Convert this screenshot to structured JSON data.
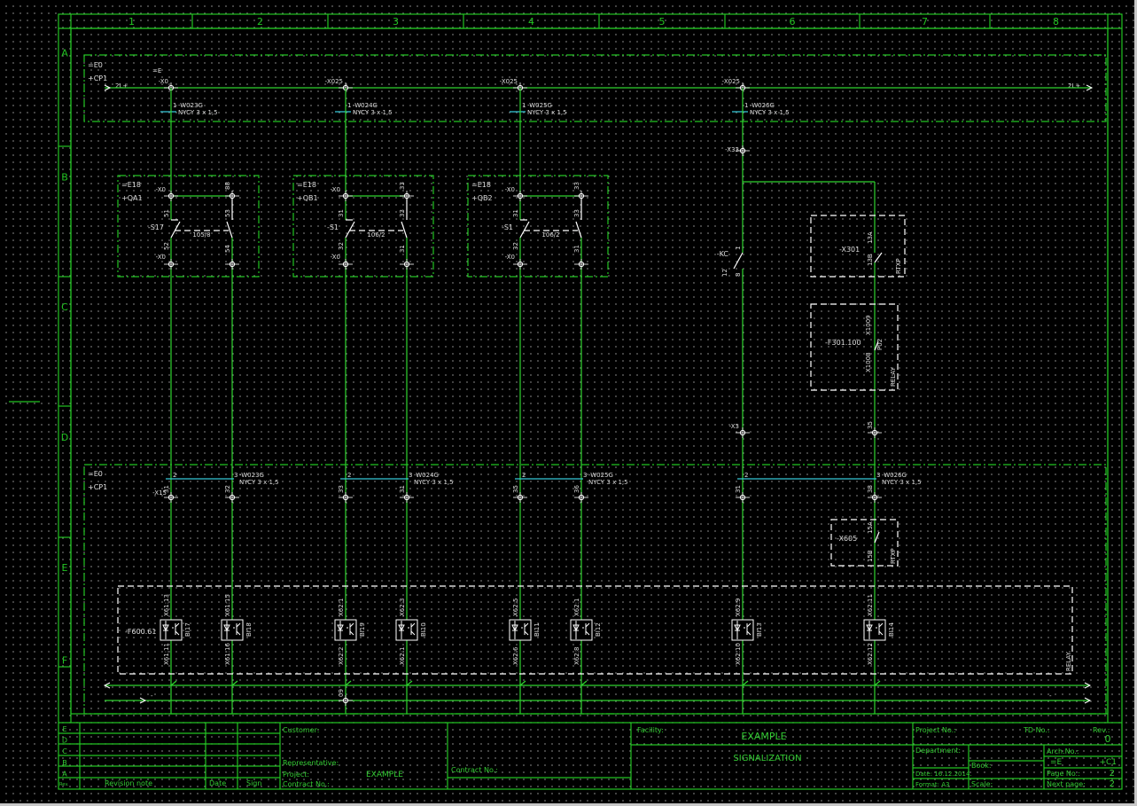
{
  "colors": {
    "frame": "#22c322",
    "wire": "#2fd42f",
    "cable": "#35c8d8",
    "symbol": "#ffffff",
    "text": "#dddddd",
    "title_text": "#33cc33"
  },
  "frame": {
    "columns": [
      "1",
      "2",
      "3",
      "4",
      "5",
      "6",
      "7",
      "8"
    ],
    "rows": [
      "A",
      "B",
      "C",
      "D",
      "E",
      "F"
    ]
  },
  "top": {
    "loc": "=E0",
    "plus": "+CP1",
    "eq": "=E",
    "net_left": "2L+",
    "net_right": "2L+",
    "terminals": [
      "-X0",
      "-X025",
      "-X025",
      "-X025"
    ],
    "cables": [
      {
        "pin": "1",
        "name": "-W023G",
        "type": "NYCY  3 x 1,5"
      },
      {
        "pin": "1",
        "name": "-W024G",
        "type": "NYCY  3 x 1,5"
      },
      {
        "pin": "1",
        "name": "-W025G",
        "type": "NYCY  3 x 1,5"
      },
      {
        "pin": "1",
        "name": "-W026G",
        "type": "NYCY  3 x 1,5"
      }
    ],
    "x3_top": "-X33"
  },
  "modules": [
    {
      "loc": "=E18",
      "plus": "+QA1",
      "term": "-X0",
      "dev": "-S17",
      "ref": "105/8",
      "pins": [
        "51",
        "52",
        "53",
        "54"
      ],
      "tp": [
        "",
        "",
        "88",
        "181"
      ]
    },
    {
      "loc": "=E18",
      "plus": "+QB1",
      "term": "-X0",
      "dev": "-S1",
      "ref": "106/2",
      "pins": [
        "31",
        "32",
        "33",
        "31"
      ],
      "tp": [
        "31",
        "32",
        "33",
        "31"
      ]
    },
    {
      "loc": "=E18",
      "plus": "+QB2",
      "term": "-X0",
      "dev": "-S1",
      "ref": "106/2",
      "pins": [
        "31",
        "32",
        "33",
        "31"
      ],
      "tp": [
        "31",
        "32",
        "33",
        "31"
      ]
    }
  ],
  "kc": {
    "dev": "-KC",
    "pins": [
      "1",
      "12",
      "8"
    ]
  },
  "x301": {
    "dev": "-X301",
    "pins": [
      "13A",
      "13B"
    ],
    "type": "RTXP"
  },
  "f301": {
    "dev": "-F301.100",
    "pins": [
      "X1009",
      "X1008"
    ],
    "code": "P02",
    "type": "RELAY"
  },
  "x3_bottom": {
    "term": "-X3",
    "pin": "35"
  },
  "bottom": {
    "loc": "=E0",
    "plus": "+CP1",
    "term": "-X15",
    "cables": [
      {
        "a": "2",
        "b": "3",
        "name": "-W023G",
        "type": "NYCY  3 x 1,5"
      },
      {
        "a": "2",
        "b": "3",
        "name": "-W024G",
        "type": "NYCY  3 x 1,5"
      },
      {
        "a": "2",
        "b": "3",
        "name": "-W025G",
        "type": "NYCY  3 x 1,5"
      },
      {
        "a": "2",
        "b": "3",
        "name": "-W026G",
        "type": "NYCY  3 x 1,5"
      }
    ],
    "terms": [
      "31",
      "32",
      "33",
      "31",
      "35",
      "36",
      "31",
      "38"
    ]
  },
  "x605": {
    "dev": "-X605",
    "pins": [
      "15A",
      "15B"
    ],
    "type": "RTXP"
  },
  "relay": {
    "dev": "-F600.61",
    "type": "RELAY",
    "inputs": [
      {
        "top": "X61:13",
        "bot": "X61:11",
        "bi": "BI17"
      },
      {
        "top": "X61:15",
        "bot": "X61:16",
        "bi": "BI18"
      },
      {
        "top": "X62:1",
        "bot": "X62:2",
        "bi": "BI19"
      },
      {
        "top": "X62:3",
        "bot": "X62:1",
        "bi": "BI10"
      },
      {
        "top": "X62:5",
        "bot": "X62:6",
        "bi": "BI11"
      },
      {
        "top": "X62:1",
        "bot": "X62:8",
        "bi": "BI12"
      },
      {
        "top": "X62:9",
        "bot": "X62:10",
        "bi": "BI13"
      },
      {
        "top": "X62:11",
        "bot": "X62:12",
        "bi": "BI14"
      }
    ],
    "bus_term": "09",
    "bus_minus": "-"
  },
  "title_block": {
    "rev_rows": [
      "E",
      "D",
      "C",
      "B",
      "A"
    ],
    "rev_header": {
      "num": "Rev.",
      "note": "Revision note",
      "date": "Date",
      "sign": "Sign"
    },
    "customer": "Customer:",
    "representative": "Representative:",
    "project_label": "Project:",
    "project": "EXAMPLE",
    "contract": "Contract No.:",
    "contract2": "Contract No.:",
    "facility": "Facility:",
    "facility_value": "EXAMPLE",
    "drawing_title": "SIGNALIZATION",
    "project_no": "Project No.:",
    "td_no": "TD No.:",
    "rev_label": "Rev.:",
    "rev_value": "0",
    "department": "Department:",
    "date": "Date: 16.12.2014.",
    "format": "Format: A3",
    "book": "Book:",
    "scale": "Scale:",
    "arch_no": "Arch.No.:",
    "arch_eq": "=E",
    "arch_loc": "+C1",
    "page_label": "Page No.:",
    "page": "2",
    "next_label": "Next page:",
    "next": "2"
  }
}
